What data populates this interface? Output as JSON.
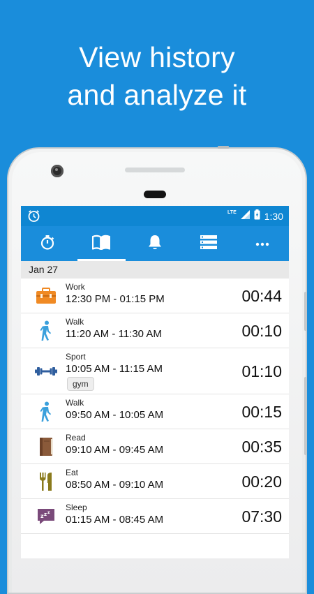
{
  "headline": {
    "line1": "View history",
    "line2": "and analyze it"
  },
  "status_bar": {
    "network": "LTE",
    "time": "1:30"
  },
  "tabs": [
    {
      "id": "timer",
      "icon": "stopwatch-icon",
      "active": false
    },
    {
      "id": "history",
      "icon": "book-icon",
      "active": true
    },
    {
      "id": "reminders",
      "icon": "bell-icon",
      "active": false
    },
    {
      "id": "activities",
      "icon": "list-icon",
      "active": false
    },
    {
      "id": "more",
      "icon": "more-icon",
      "active": false
    }
  ],
  "history": {
    "date": "Jan 27",
    "entries": [
      {
        "name": "Work",
        "time": "12:30 PM - 01:15 PM",
        "duration": "00:44",
        "icon": "toolbox-icon"
      },
      {
        "name": "Walk",
        "time": "11:20 AM - 11:30 AM",
        "duration": "00:10",
        "icon": "walk-icon"
      },
      {
        "name": "Sport",
        "time": "10:05 AM - 11:15 AM",
        "duration": "01:10",
        "icon": "dumbbell-icon",
        "tag": "gym"
      },
      {
        "name": "Walk",
        "time": "09:50 AM - 10:05 AM",
        "duration": "00:15",
        "icon": "walk-icon"
      },
      {
        "name": "Read",
        "time": "09:10 AM - 09:45 AM",
        "duration": "00:35",
        "icon": "book-read-icon"
      },
      {
        "name": "Eat",
        "time": "08:50 AM - 09:10 AM",
        "duration": "00:20",
        "icon": "utensils-icon"
      },
      {
        "name": "Sleep",
        "time": "01:15 AM - 08:45 AM",
        "duration": "07:30",
        "icon": "sleep-icon"
      }
    ]
  },
  "colors": {
    "background": "#1a8ddb",
    "status_bar": "#0f86d2",
    "work": "#f08a24",
    "walk": "#3aa0dc",
    "sport": "#2f5e9e",
    "read": "#8a5a3a",
    "eat": "#8a7a1c",
    "sleep": "#7a4a7a"
  }
}
